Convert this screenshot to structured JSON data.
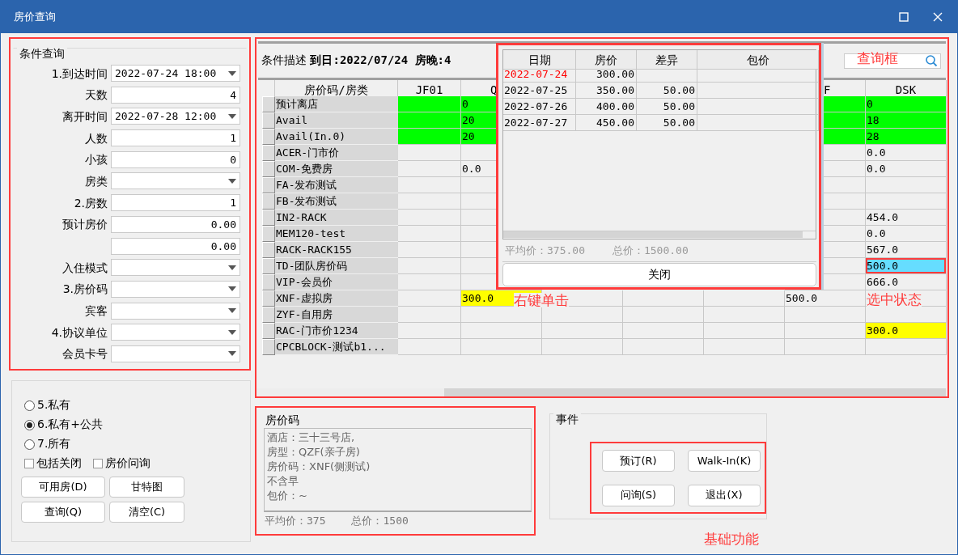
{
  "window": {
    "title": "房价查询"
  },
  "criteria": {
    "title": "条件查询",
    "fields": [
      {
        "label": "1.到达时间",
        "kind": "dropdown",
        "value": "2022-07-24 18:00"
      },
      {
        "label": "天数",
        "kind": "number",
        "value": "4"
      },
      {
        "label": "离开时间",
        "kind": "dropdown",
        "value": "2022-07-28 12:00"
      },
      {
        "label": "人数",
        "kind": "number",
        "value": "1"
      },
      {
        "label": "小孩",
        "kind": "number",
        "value": "0"
      },
      {
        "label": "房类",
        "kind": "dropdown"
      },
      {
        "label": "2.房数",
        "kind": "number",
        "value": "1"
      },
      {
        "label": "预计房价",
        "kind": "number",
        "value": "0.00"
      },
      {
        "kind": "number",
        "value": "0.00"
      },
      {
        "label": "入住模式",
        "kind": "dropdown"
      },
      {
        "label": "3.房价码",
        "kind": "dropdown"
      },
      {
        "label": "宾客",
        "kind": "dropdown"
      },
      {
        "label": "4.协议单位",
        "kind": "dropdown"
      },
      {
        "label": "会员卡号",
        "kind": "dropdown"
      }
    ]
  },
  "scope": [
    {
      "label": "5.私有",
      "selected": false
    },
    {
      "label": "6.私有+公共",
      "selected": true
    },
    {
      "label": "7.所有",
      "selected": false
    }
  ],
  "options": [
    {
      "label": "包括关闭",
      "checked": false
    },
    {
      "label": "房价问询",
      "checked": false
    }
  ],
  "left_buttons": [
    "可用房(D)",
    "甘特图",
    "查询(Q)",
    "清空(C)"
  ],
  "condition": "条件描述 **到日:2022/07/24 房晚:4**",
  "grid": {
    "corner": "房价码/房类",
    "columns": [
      "JF01",
      "Q",
      "F",
      "DSK"
    ],
    "rows": [
      {
        "label": "预计离店",
        "cells": [
          {
            "color": "#00ff00",
            "selected": false
          },
          {
            "text": "0",
            "color": "#00ff00",
            "selected": false
          },
          {
            "color": "#00ff00",
            "selected": false
          },
          {
            "text": "0",
            "color": "#00ff00",
            "selected": false
          }
        ]
      },
      {
        "label": "Avail",
        "cells": [
          {
            "color": "#00ff00",
            "selected": false
          },
          {
            "text": "20",
            "color": "#00ff00",
            "selected": false
          },
          {
            "color": "#00ff00",
            "selected": false
          },
          {
            "text": "18",
            "color": "#00ff00",
            "selected": false
          }
        ]
      },
      {
        "label": "Avail(In.0)",
        "cells": [
          {
            "color": "#00ff00",
            "selected": false
          },
          {
            "text": "20",
            "color": "#00ff00",
            "selected": false
          },
          {
            "color": "#00ff00",
            "selected": false
          },
          {
            "text": "28",
            "color": "#00ff00",
            "selected": false
          }
        ]
      },
      {
        "label": "ACER-门市价",
        "cells": [
          {
            "selected": false
          },
          {
            "selected": false
          },
          {
            "selected": false
          },
          {
            "text": "0.0",
            "selected": false
          }
        ]
      },
      {
        "label": "COM-免费房",
        "cells": [
          {
            "selected": false
          },
          {
            "text": "0.0",
            "selected": false
          },
          {
            "selected": false
          },
          {
            "text": "0.0",
            "selected": false
          }
        ]
      },
      {
        "label": "FA-发布测试",
        "cells": [
          {
            "selected": false
          },
          {
            "selected": false
          },
          {
            "selected": false
          },
          {
            "selected": false
          }
        ]
      },
      {
        "label": "FB-发布测试",
        "cells": [
          {
            "selected": false
          },
          {
            "selected": false
          },
          {
            "selected": false
          },
          {
            "selected": false
          }
        ]
      },
      {
        "label": "IN2-RACK",
        "cells": [
          {
            "selected": false
          },
          {
            "selected": false
          },
          {
            "selected": false
          },
          {
            "text": "454.0",
            "selected": false
          }
        ]
      },
      {
        "label": "MEM120-test",
        "cells": [
          {
            "selected": false
          },
          {
            "selected": false
          },
          {
            "selected": false
          },
          {
            "text": "0.0",
            "selected": false
          }
        ]
      },
      {
        "label": "RACK-RACK155",
        "cells": [
          {
            "selected": false
          },
          {
            "selected": false
          },
          {
            "selected": false
          },
          {
            "text": "567.0",
            "selected": false
          }
        ]
      },
      {
        "label": "TD-团队房价码",
        "cells": [
          {
            "selected": false
          },
          {
            "selected": false
          },
          {
            "selected": false
          },
          {
            "text": "500.0",
            "color": "#66ddff",
            "selected": true
          }
        ]
      },
      {
        "label": "VIP-会员价",
        "cells": [
          {
            "selected": false
          },
          {
            "selected": false
          },
          {
            "selected": false
          },
          {
            "text": "666.0",
            "selected": false
          }
        ]
      },
      {
        "label": "XNF-虚拟房",
        "cells": [
          {
            "selected": false
          },
          {
            "text": "300.0",
            "color": "#ffff00",
            "selected": false
          },
          {
            "selected": false
          },
          {
            "selected": false
          },
          {
            "selected": false
          },
          {
            "text": "500.0",
            "selected": false
          },
          {
            "selected": false
          }
        ]
      },
      {
        "label": "ZYF-自用房",
        "cells": [
          {
            "selected": false
          },
          {
            "selected": false
          },
          {
            "selected": false
          },
          {
            "selected": false
          },
          {
            "selected": false
          },
          {
            "selected": false
          },
          {
            "selected": false
          }
        ]
      },
      {
        "label": "RAC-门市价1234",
        "cells": [
          {
            "selected": false
          },
          {
            "selected": false
          },
          {
            "selected": false
          },
          {
            "selected": false
          },
          {
            "selected": false
          },
          {
            "selected": false
          },
          {
            "text": "300.0",
            "color": "#ffff00",
            "selected": false
          }
        ]
      },
      {
        "label": "CPCBLOCK-测试b1...",
        "cells": [
          {
            "selected": false
          },
          {
            "selected": false
          },
          {
            "selected": false
          },
          {
            "selected": false
          },
          {
            "selected": false
          },
          {
            "selected": false
          },
          {
            "selected": false
          }
        ]
      }
    ]
  },
  "popup": {
    "columns": [
      "日期",
      "房价",
      "差异",
      "包价"
    ],
    "rows": [
      {
        "date": "2022-07-24",
        "rate": "300.00",
        "color": "#ff0000"
      },
      {
        "date": "2022-07-25",
        "rate": "350.00",
        "difference": "50.00",
        "color": "#000000"
      },
      {
        "date": "2022-07-26",
        "rate": "400.00",
        "difference": "50.00",
        "color": "#000000"
      },
      {
        "date": "2022-07-27",
        "rate": "450.00",
        "difference": "50.00",
        "color": "#000000"
      }
    ],
    "average": "平均价：375.00",
    "total": "总价：1500.00",
    "close": "关闭"
  },
  "rate_code": {
    "title": "房价码",
    "lines": [
      "酒店：三十三号店,",
      "房型：QZF(亲子房)",
      "房价码：XNF(侧测试)",
      "不含早",
      "包价：~"
    ],
    "average": "平均价：375",
    "total": "总价：1500"
  },
  "events": {
    "title": "事件",
    "buttons": [
      "预订(R)",
      "Walk-In(K)",
      "问询(S)",
      "退出(X)"
    ]
  },
  "annotations": [
    "查询框",
    "右键单击",
    "选中状态",
    "基础功能"
  ]
}
